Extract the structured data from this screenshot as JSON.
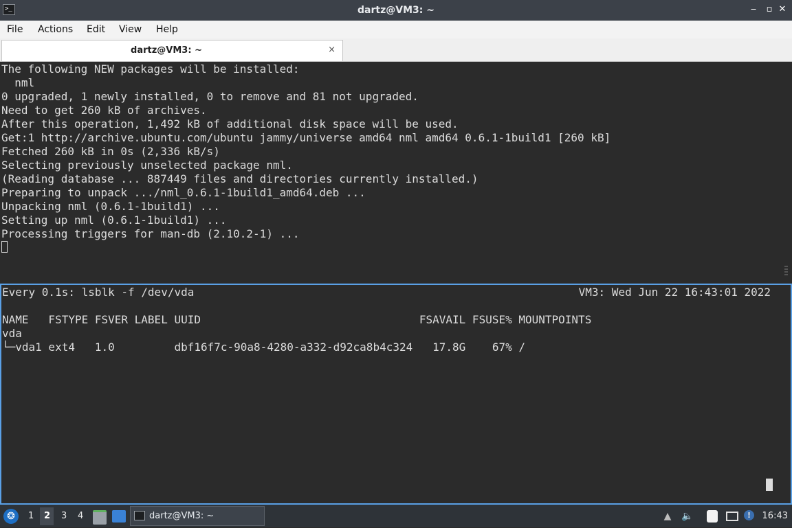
{
  "window": {
    "title": "dartz@VM3: ~",
    "minimize_glyph": "‒",
    "maximize_glyph": "▫",
    "close_glyph": "✕",
    "app_icon_glyph": ">_"
  },
  "menu": [
    "File",
    "Actions",
    "Edit",
    "View",
    "Help"
  ],
  "tab": {
    "label": "dartz@VM3: ~",
    "close_glyph": "×"
  },
  "top_pane": {
    "lines": [
      "The following NEW packages will be installed:",
      "  nml",
      "0 upgraded, 1 newly installed, 0 to remove and 81 not upgraded.",
      "Need to get 260 kB of archives.",
      "After this operation, 1,492 kB of additional disk space will be used.",
      "Get:1 http://archive.ubuntu.com/ubuntu jammy/universe amd64 nml amd64 0.6.1-1build1 [260 kB]",
      "Fetched 260 kB in 0s (2,336 kB/s)",
      "Selecting previously unselected package nml.",
      "(Reading database ... 887449 files and directories currently installed.)",
      "Preparing to unpack .../nml_0.6.1-1build1_amd64.deb ...",
      "Unpacking nml (0.6.1-1build1) ...",
      "Setting up nml (0.6.1-1build1) ...",
      "Processing triggers for man-db (2.10.2-1) ..."
    ]
  },
  "bottom_pane": {
    "watch_header_left": "Every 0.1s: lsblk -f /dev/vda",
    "watch_header_right": "VM3: Wed Jun 22 16:43:01 2022",
    "table_header": "NAME   FSTYPE FSVER LABEL UUID                                 FSAVAIL FSUSE% MOUNTPOINTS",
    "rows": [
      "vda",
      "└─vda1 ext4   1.0         dbf16f7c-90a8-4280-a332-d92ca8b4c324   17.8G    67% /"
    ]
  },
  "taskbar": {
    "start_glyph": "❂",
    "workspaces": [
      "1",
      "2",
      "3",
      "4"
    ],
    "active_workspace": "2",
    "task_label": "dartz@VM3: ~",
    "clock": "16:43",
    "tray": {
      "up_glyph": "▲",
      "volume_glyph": "🔈",
      "notify_glyph": "!"
    }
  },
  "colors": {
    "terminal_bg": "#2b2b2b",
    "terminal_fg": "#dcdcdc",
    "active_pane_border": "#5aa0e6",
    "titlebar_bg": "#3c4149",
    "taskbar_bg": "#2e3338"
  }
}
